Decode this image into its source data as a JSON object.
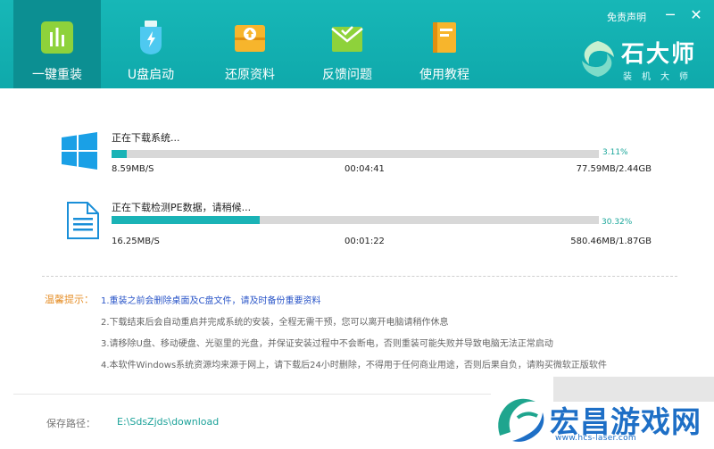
{
  "nav": [
    {
      "label": "一键重装",
      "icon": "chart-bars-icon",
      "active": true
    },
    {
      "label": "U盘启动",
      "icon": "usb-drive-icon",
      "active": false
    },
    {
      "label": "还原资料",
      "icon": "restore-box-icon",
      "active": false
    },
    {
      "label": "反馈问题",
      "icon": "feedback-envelope-icon",
      "active": false
    },
    {
      "label": "使用教程",
      "icon": "book-icon",
      "active": false
    }
  ],
  "topbar": {
    "disclaimer": "免责声明",
    "minimize": "─",
    "close": "✕"
  },
  "brand": {
    "title": "石大师",
    "subtitle": "装机大师"
  },
  "downloads": [
    {
      "icon": "windows-logo-icon",
      "title": "正在下载系统...",
      "progress": 3.11,
      "percent_text": "3.11%",
      "speed": "8.59MB/S",
      "time": "00:04:41",
      "size": "77.59MB/2.44GB"
    },
    {
      "icon": "document-icon",
      "title": "正在下载检测PE数据，请稍候...",
      "progress": 30.32,
      "percent_text": "30.32%",
      "speed": "16.25MB/S",
      "time": "00:01:22",
      "size": "580.46MB/1.87GB"
    }
  ],
  "tips": {
    "label": "温馨提示：",
    "items": [
      "1.重装之前会删除桌面及C盘文件，请及时备份重要资料",
      "2.下载结束后会自动重启并完成系统的安装，全程无需干预，您可以离开电脑请稍作休息",
      "3.请移除U盘、移动硬盘、光驱里的光盘，并保证安装过程中不会断电，否则重装可能失败并导致电脑无法正常启动",
      "4.本软件Windows系统资源均来源于网上，请下载后24小时删除，不得用于任何商业用途，否则后果自负，请购买微软正版软件"
    ]
  },
  "save_path": {
    "label": "保存路径：",
    "value": "E:\\SdsZjds\\download"
  },
  "watermark": {
    "title": "宏昌游戏网",
    "url": "www.hcs-laser.com"
  },
  "colors": {
    "header": "#14b1b2",
    "accent": "#1ab3b6",
    "tip_highlight": "#2a55c8",
    "tip_label": "#e6902b"
  }
}
